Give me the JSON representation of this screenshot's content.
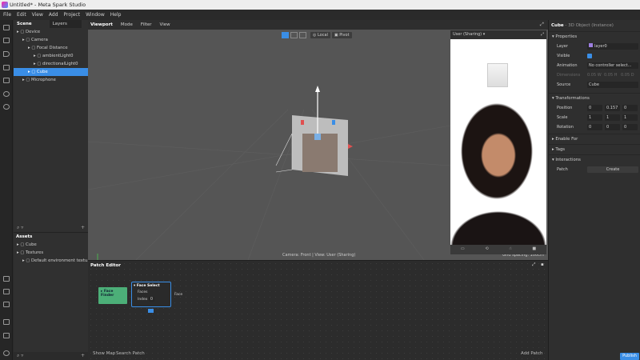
{
  "window": {
    "title": "Untitled* - Meta Spark Studio"
  },
  "menu": [
    "File",
    "Edit",
    "View",
    "Add",
    "Project",
    "Window",
    "Help"
  ],
  "scene_panel": {
    "tabs": [
      "Scene",
      "Layers"
    ],
    "items": [
      {
        "label": "Device",
        "icon": "phone-icon",
        "depth": 0
      },
      {
        "label": "Camera",
        "icon": "camera-icon",
        "depth": 1
      },
      {
        "label": "Focal Distance",
        "icon": "focal-icon",
        "depth": 2
      },
      {
        "label": "ambientLight0",
        "icon": "ambient-light-icon",
        "depth": 3
      },
      {
        "label": "directionalLight0",
        "icon": "directional-light-icon",
        "depth": 3
      },
      {
        "label": "Cube",
        "icon": "cube-icon",
        "depth": 2,
        "selected": true
      },
      {
        "label": "Microphone",
        "icon": "microphone-icon",
        "depth": 1
      }
    ]
  },
  "assets_panel": {
    "title": "Assets",
    "items": [
      {
        "label": "Cube",
        "depth": 0
      },
      {
        "label": "Textures",
        "depth": 0
      },
      {
        "label": "Default environment textu...",
        "depth": 1
      }
    ]
  },
  "viewport": {
    "tabs": [
      "Viewport",
      "Mode",
      "Filter",
      "View"
    ],
    "local_label": "Local",
    "pivot_label": "Pivot",
    "status": "Camera: Front | View: User (Sharing)",
    "grid": "Grid spacing: 100cm",
    "preview_label": "User (Sharing)"
  },
  "patch_editor": {
    "title": "Patch Editor",
    "face_finder": "Face Finder",
    "face_select": "Face Select",
    "faces_port": "Faces",
    "index_port": "Index",
    "index_value": "0",
    "face_output": "Face",
    "show_map": "Show Map",
    "search_patch": "Search Patch",
    "add_patch": "Add Patch"
  },
  "inspector": {
    "title": "Cube",
    "subtitle": "- 3D Object (Instance)",
    "properties": "Properties",
    "layer_label": "Layer",
    "layer_value": "layer0",
    "visible_label": "Visible",
    "visible": true,
    "animation_label": "Animation",
    "animation_value": "No controller select...",
    "dimensions_label": "Dimensions",
    "dim_w": "0.05 W",
    "dim_h": "0.05 H",
    "dim_d": "0.05 D",
    "source_label": "Source",
    "source_value": "Cube",
    "transformations": "Transformations",
    "position_label": "Position",
    "position": [
      "0",
      "0.157",
      "0"
    ],
    "scale_label": "Scale",
    "scale": [
      "1",
      "1",
      "1"
    ],
    "rotation_label": "Rotation",
    "rotation": [
      "0",
      "0",
      "0"
    ],
    "enable_for": "Enable For",
    "tags": "Tags",
    "interactions": "Interactions",
    "patch_label": "Patch",
    "create_label": "Create"
  },
  "publish_label": "Publish",
  "colors": {
    "accent": "#3a8ee6",
    "patch_green": "#4caf78"
  }
}
